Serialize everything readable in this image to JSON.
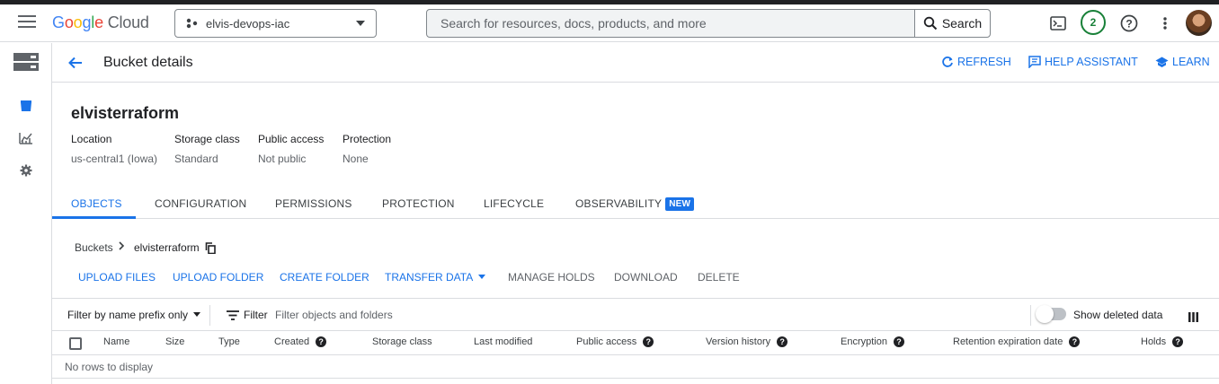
{
  "topbar": {
    "logo_google": [
      "G",
      "o",
      "o",
      "g",
      "l",
      "e"
    ],
    "logo_cloud": "Cloud",
    "project_name": "elvis-devops-iac",
    "search_placeholder": "Search for resources, docs, products, and more",
    "search_button": "Search",
    "notification_count": "2"
  },
  "header": {
    "title": "Bucket details",
    "refresh": "REFRESH",
    "help_assistant": "HELP ASSISTANT",
    "learn": "LEARN"
  },
  "bucket": {
    "name": "elvisterraform",
    "fields": [
      {
        "label": "Location",
        "value": "us-central1 (Iowa)"
      },
      {
        "label": "Storage class",
        "value": "Standard"
      },
      {
        "label": "Public access",
        "value": "Not public"
      },
      {
        "label": "Protection",
        "value": "None"
      }
    ]
  },
  "tabs": [
    {
      "label": "OBJECTS",
      "active": true
    },
    {
      "label": "CONFIGURATION"
    },
    {
      "label": "PERMISSIONS"
    },
    {
      "label": "PROTECTION"
    },
    {
      "label": "LIFECYCLE"
    },
    {
      "label": "OBSERVABILITY",
      "badge": "NEW"
    }
  ],
  "breadcrumb": {
    "root": "Buckets",
    "current": "elvisterraform"
  },
  "actions": {
    "upload_files": "UPLOAD FILES",
    "upload_folder": "UPLOAD FOLDER",
    "create_folder": "CREATE FOLDER",
    "transfer_data": "TRANSFER DATA",
    "manage_holds": "MANAGE HOLDS",
    "download": "DOWNLOAD",
    "delete": "DELETE"
  },
  "filter": {
    "mode": "Filter by name prefix only",
    "label": "Filter",
    "placeholder": "Filter objects and folders",
    "show_deleted": "Show deleted data",
    "show_deleted_on": false
  },
  "table": {
    "columns": [
      "Name",
      "Size",
      "Type",
      "Created",
      "Storage class",
      "Last modified",
      "Public access",
      "Version history",
      "Encryption",
      "Retention expiration date",
      "Holds"
    ],
    "empty_text": "No rows to display"
  },
  "colors": {
    "accent": "#1a73e8",
    "badge_green": "#188038"
  }
}
